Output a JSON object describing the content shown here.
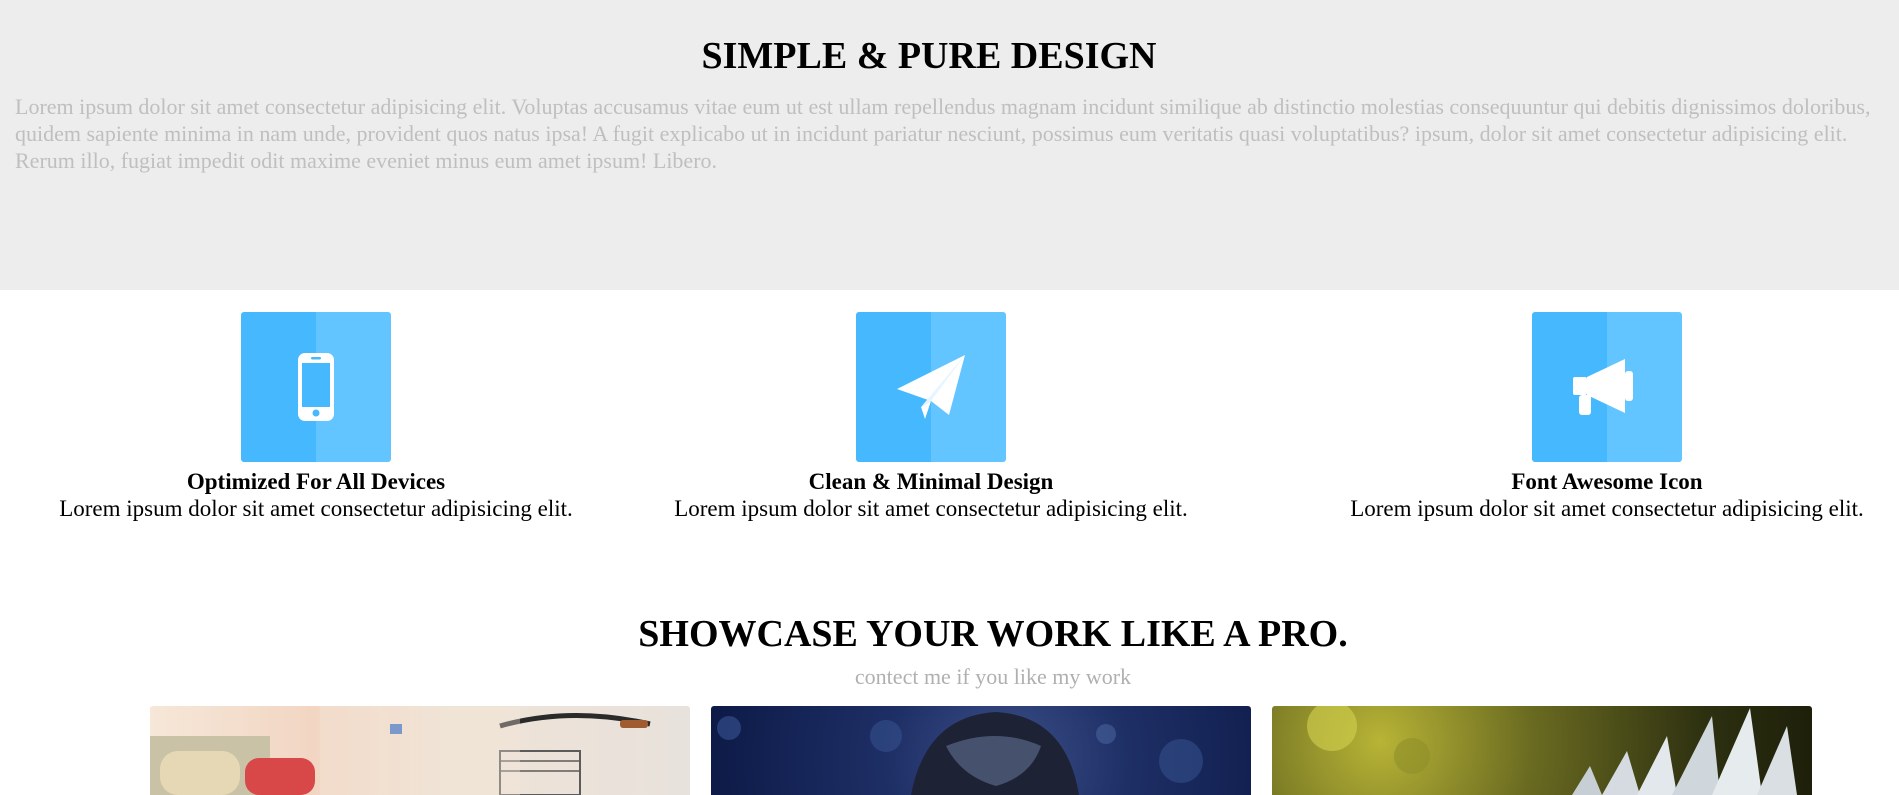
{
  "hero": {
    "title": "SIMPLE & PURE DESIGN",
    "description": "Lorem ipsum dolor sit amet consectetur adipisicing elit. Voluptas accusamus vitae eum ut est ullam repellendus magnam incidunt similique ab distinctio molestias consequuntur qui debitis dignissimos doloribus, quidem sapiente minima in nam unde, provident quos natus ipsa! A fugit explicabo ut in incidunt pariatur nesciunt, possimus eum veritatis quasi voluptatibus? ipsum, dolor sit amet consectetur adipisicing elit. Rerum illo, fugiat impedit odit maxime eveniet minus eum amet ipsum! Libero."
  },
  "features": [
    {
      "icon": "mobile-phone-icon",
      "title": "Optimized For All Devices",
      "text": "Lorem ipsum dolor sit amet consectetur adipisicing elit."
    },
    {
      "icon": "paper-plane-icon",
      "title": "Clean & Minimal Design",
      "text": "Lorem ipsum dolor sit amet consectetur adipisicing elit."
    },
    {
      "icon": "bullhorn-icon",
      "title": "Font Awesome Icon",
      "text": "Lorem ipsum dolor sit amet consectetur adipisicing elit."
    }
  ],
  "showcase": {
    "title": "SHOWCASE YOUR WORK LIKE A PRO.",
    "subtitle": "contect me if you like my work",
    "items": [
      {
        "image": "street-bicycle-photo"
      },
      {
        "image": "portrait-bokeh-photo"
      },
      {
        "image": "nature-leaves-photo"
      }
    ]
  },
  "colors": {
    "hero_bg": "#ededed",
    "icon_bg": "#46b8fd",
    "icon_bg_light": "#62c5ff",
    "muted_text": "#bfbfbf"
  }
}
